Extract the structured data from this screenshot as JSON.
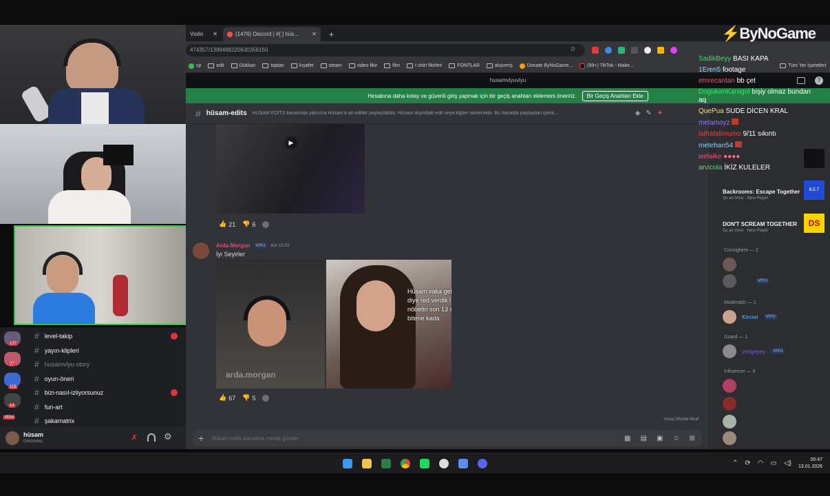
{
  "browser": {
    "tabs": [
      {
        "label": "Violin"
      },
      {
        "label": "(1476) Discord | #[ ] hüs..."
      }
    ],
    "url": "474357/1399488220630356150",
    "bookmarks": [
      "sp",
      "edit",
      "Dükkan",
      "toptan",
      "kıyafet",
      "steam",
      "video fikir",
      "film",
      "t shirt fikirleri",
      "FONTLAR",
      "alışveriş",
      "Donate ByNoGame...",
      "(99+) TikTok - Make...",
      "Tüm Yer İşaretleri"
    ]
  },
  "discord": {
    "window_title": "husamvlyuvlyu",
    "banner_text": "Hesabına daha kolay ve güvenli giriş yapmak için bir geçiş anahtarı eklemeni öneririz.",
    "banner_button": "Bir Geçiş Anahtarı Ekle",
    "channel_name": "hüsam-edits",
    "channel_topic": "HÜSAM EDİTS kanalında yalnızca Hüsam'a ait editler paylaşılabilir. Hüsam dışındaki edit veya klipler silinecektir. Bu kanalda paylaşılan içerik...",
    "messages": [
      {
        "reactions": [
          {
            "icon": "thumbs-up",
            "count": "21"
          },
          {
            "icon": "thumbs-down",
            "count": "6"
          }
        ]
      },
      {
        "author": "Arda Morgan",
        "tag": "VIYU",
        "time": "dün 15:33",
        "text": "İyi Seyirler",
        "overlay_lines": [
          "Hüsam vaka gel",
          "diye red verdik l",
          "nöbetin son 13 s",
          "bitene kada"
        ],
        "watermark": "arda.morgan",
        "reactions": [
          {
            "icon": "thumbs-up",
            "count": "67"
          },
          {
            "icon": "thumbs-down",
            "count": "5"
          }
        ]
      }
    ],
    "typing": "Yavaş Modda Muaf",
    "composer_placeholder": "hüsam-edits kanalına mesaj gönder"
  },
  "sidebar": {
    "channels": [
      {
        "label": "level-takip",
        "unread": true
      },
      {
        "label": "yayın-klipleri",
        "unread": false
      },
      {
        "label": "husamvlyu-story",
        "unread": false,
        "muted": true
      },
      {
        "label": "oyun-öneri",
        "unread": false
      },
      {
        "label": "bizi-nasıl-izliyorsunuz",
        "unread": true
      },
      {
        "label": "fun-art",
        "unread": false
      },
      {
        "label": "şakamatrix",
        "unread": false
      }
    ],
    "guild_badges": [
      "127",
      "27",
      "115",
      "14",
      "YENİ"
    ],
    "user": {
      "name": "hüsam",
      "status": "Görünmez"
    }
  },
  "members": {
    "games": [
      {
        "title": "Backrooms: Escape Together",
        "sub": "Şu an önce · New Player",
        "code": "B.E.T"
      },
      {
        "title": "DON'T SCREAM TOGETHER",
        "sub": "Şu an önce · New Player",
        "code": "DS"
      }
    ],
    "sections": [
      {
        "label": "Consigliere — 2"
      },
      {
        "label": "Moderatör — 1"
      },
      {
        "label": "Guard — 1"
      },
      {
        "label": "İnfluencer — 6"
      }
    ],
    "named": [
      {
        "name": "Kinowi",
        "tag": "VIYU"
      },
      {
        "name": "yengeyey",
        "tag": "VIYU"
      }
    ]
  },
  "chat": [
    {
      "user": "SadikBeyy",
      "msg": "BASI KAPA"
    },
    {
      "user": "1Eren5",
      "msg": "footage"
    },
    {
      "user": "emrecantan",
      "msg": "bb çet"
    },
    {
      "user": "DogukanKaragol",
      "msg": "bişiy olmaz bundan"
    },
    {
      "user": "",
      "msg": "aq"
    },
    {
      "user": "QuePua",
      "msg": "SUDE DİCEN KRAL"
    },
    {
      "user": "melamoyz",
      "msg": ""
    },
    {
      "user": "isthatalimumo",
      "msg": "9/11 sıkıntı"
    },
    {
      "user": "metehan54",
      "msg": ""
    },
    {
      "user": "welaike",
      "msg": ""
    },
    {
      "user": "arvicola",
      "msg": "İKİZ KULELER"
    }
  ],
  "overlay": {
    "logo": "ByNoGame"
  },
  "taskbar": {
    "time": "00:47",
    "date": "13.01.2026"
  },
  "colors": {
    "discord_bg": "#313338",
    "sidebar_bg": "#2b2d31",
    "banner": "#248046",
    "chat_user": "#38e070",
    "mention_red": "#da373c"
  }
}
